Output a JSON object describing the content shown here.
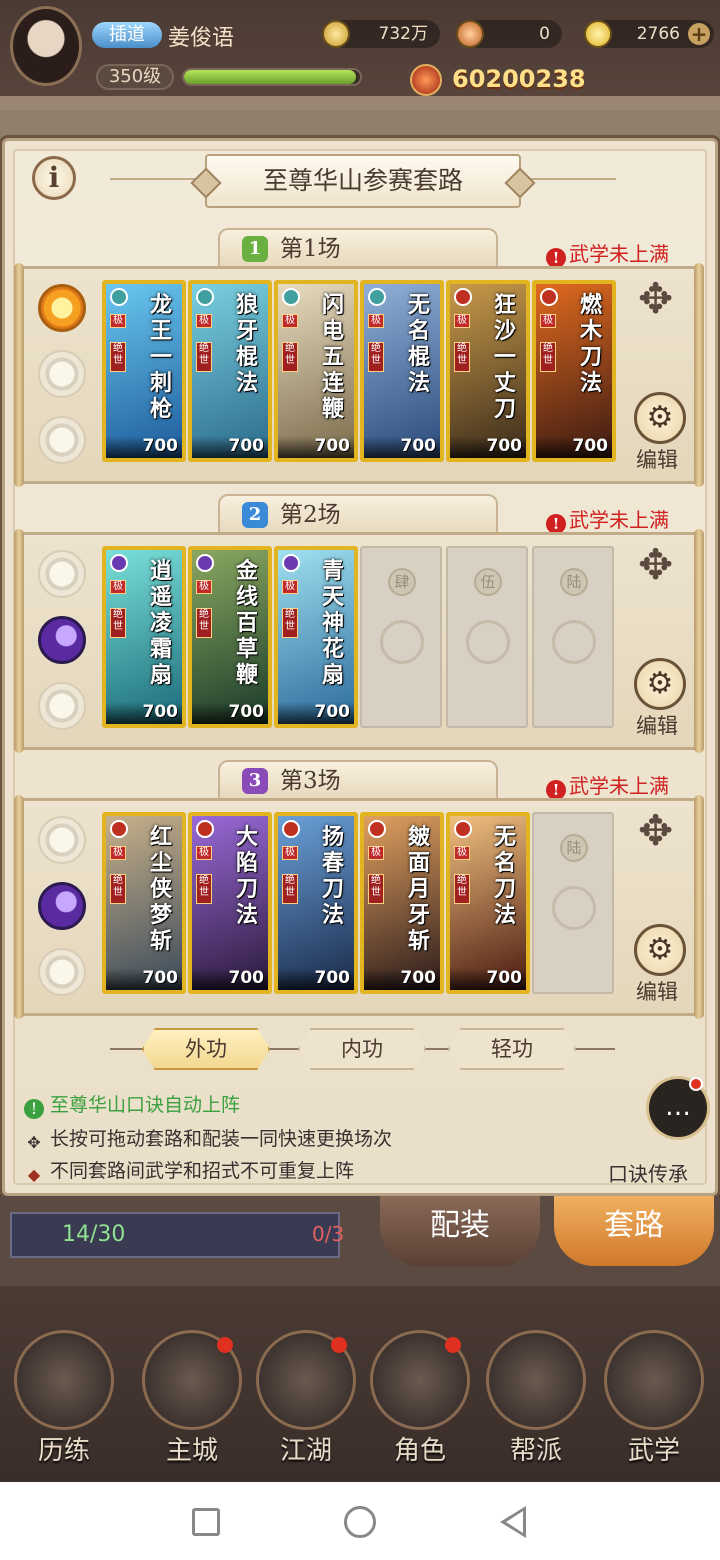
{
  "player": {
    "vip_tag": "插道",
    "name": "姜俊语",
    "level": "350级",
    "exp_fraction": 0.98,
    "power": "60200238"
  },
  "resources": [
    {
      "value": "732万"
    },
    {
      "value": "0"
    },
    {
      "value": "2766"
    }
  ],
  "panel": {
    "title": "至尊华山参赛套路",
    "warning_text": "武学未上满",
    "edit_label": "编辑"
  },
  "sections": [
    {
      "label": "第1场",
      "num": "1",
      "badge_color": "#6ab040",
      "active_orb": "sun",
      "cards": [
        {
          "name": "龙王一刺枪",
          "level": "700",
          "tag": "极",
          "tag2": "绝世",
          "colors": [
            "#1c5a9a",
            "#6ac8f0"
          ],
          "gem": "#40a0a0"
        },
        {
          "name": "狼牙棍法",
          "level": "700",
          "tag": "极",
          "tag2": "绝世",
          "colors": [
            "#2a6a8a",
            "#7ad0e0"
          ],
          "gem": "#40a0a0"
        },
        {
          "name": "闪电五连鞭",
          "level": "700",
          "tag": "极",
          "tag2": "绝世",
          "colors": [
            "#7a6a4a",
            "#e8dcc0"
          ],
          "gem": "#40a0a0"
        },
        {
          "name": "无名棍法",
          "level": "700",
          "tag": "极",
          "tag2": "绝世",
          "colors": [
            "#2a4a7a",
            "#90b0d8"
          ],
          "gem": "#40a0a0"
        },
        {
          "name": "狂沙一丈刀",
          "level": "700",
          "tag": "极",
          "tag2": "绝世",
          "colors": [
            "#3a2a1a",
            "#c89a4a"
          ],
          "gem": "#c03020"
        },
        {
          "name": "燃木刀法",
          "level": "700",
          "tag": "极",
          "tag2": "绝世",
          "colors": [
            "#3a1a12",
            "#e06a20"
          ],
          "gem": "#c03020"
        }
      ],
      "empty_slots": []
    },
    {
      "label": "第2场",
      "num": "2",
      "badge_color": "#3a8ad8",
      "active_orb": "moon",
      "cards": [
        {
          "name": "逍遥凌霜扇",
          "level": "700",
          "tag": "极",
          "tag2": "绝世",
          "colors": [
            "#1a6a7a",
            "#7ae0d8"
          ],
          "gem": "#6a3ab0"
        },
        {
          "name": "金线百草鞭",
          "level": "700",
          "tag": "极",
          "tag2": "绝世",
          "colors": [
            "#1a3a2a",
            "#8aa860"
          ],
          "gem": "#6a3ab0"
        },
        {
          "name": "青天神花扇",
          "level": "700",
          "tag": "极",
          "tag2": "绝世",
          "colors": [
            "#2a6a9a",
            "#a0e0f0"
          ],
          "gem": "#6a3ab0"
        }
      ],
      "empty_slots": [
        "肆",
        "伍",
        "陆"
      ]
    },
    {
      "label": "第3场",
      "num": "3",
      "badge_color": "#8a4ab8",
      "active_orb": "moon",
      "cards": [
        {
          "name": "红尘侠梦斩",
          "level": "700",
          "tag": "极",
          "tag2": "绝世",
          "colors": [
            "#3a4a5a",
            "#c8b08a"
          ],
          "gem": "#c03020"
        },
        {
          "name": "大陷刀法",
          "level": "700",
          "tag": "极",
          "tag2": "绝世",
          "colors": [
            "#2a1a3a",
            "#9a6ad8"
          ],
          "gem": "#c03020"
        },
        {
          "name": "扬春刀法",
          "level": "700",
          "tag": "极",
          "tag2": "绝世",
          "colors": [
            "#1a2a4a",
            "#6aa0d8"
          ],
          "gem": "#c03020"
        },
        {
          "name": "皴面月牙斩",
          "level": "700",
          "tag": "极",
          "tag2": "绝世",
          "colors": [
            "#2a1a1a",
            "#e0a060"
          ],
          "gem": "#c03020"
        },
        {
          "name": "无名刀法",
          "level": "700",
          "tag": "极",
          "tag2": "绝世",
          "colors": [
            "#4a1a10",
            "#f0c080"
          ],
          "gem": "#c03020"
        }
      ],
      "empty_slots": [
        "陆"
      ]
    }
  ],
  "type_tabs": [
    {
      "label": "外功",
      "active": true
    },
    {
      "label": "内功",
      "active": false
    },
    {
      "label": "轻功",
      "active": false
    }
  ],
  "tips": [
    "至尊华山口诀自动上阵",
    "长按可拖动套路和配装一同快速更换场次",
    "不同套路间武学和招式不可重复上阵"
  ],
  "kue_label": "口诀传承",
  "energy": {
    "value": "14/30",
    "other": "0/3"
  },
  "bottom_buttons": {
    "equip": "配装",
    "route": "套路"
  },
  "nav": [
    {
      "label": "历练",
      "dot": false
    },
    {
      "label": "主城",
      "dot": true
    },
    {
      "label": "江湖",
      "dot": true
    },
    {
      "label": "角色",
      "dot": true
    },
    {
      "label": "帮派",
      "dot": false
    },
    {
      "label": "武学",
      "dot": false
    }
  ]
}
